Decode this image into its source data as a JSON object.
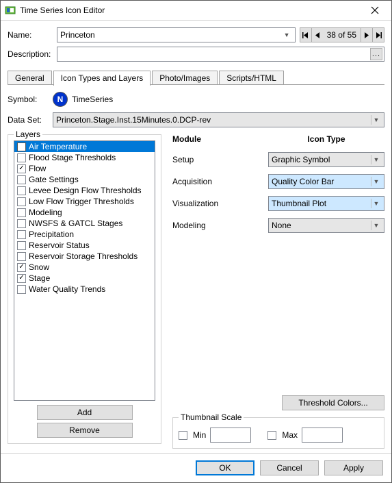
{
  "title": "Time Series Icon Editor",
  "pager": {
    "text": "38 of 55"
  },
  "form": {
    "name_label": "Name:",
    "name_value": "Princeton",
    "desc_label": "Description:",
    "desc_value": ""
  },
  "tabs": [
    "General",
    "Icon Types and Layers",
    "Photo/Images",
    "Scripts/HTML"
  ],
  "tabs_active_index": 1,
  "symbol": {
    "label": "Symbol:",
    "icon_letter": "N",
    "name": "TimeSeries"
  },
  "dataset": {
    "label": "Data Set:",
    "value": "Princeton.Stage.Inst.15Minutes.0.DCP-rev"
  },
  "layers": {
    "title": "Layers",
    "add": "Add",
    "remove": "Remove",
    "selected_index": 0,
    "items": [
      {
        "label": "Air Temperature",
        "checked": false
      },
      {
        "label": "Flood Stage Thresholds",
        "checked": false
      },
      {
        "label": "Flow",
        "checked": true
      },
      {
        "label": "Gate Settings",
        "checked": false
      },
      {
        "label": "Levee Design Flow Thresholds",
        "checked": false
      },
      {
        "label": "Low Flow Trigger Thresholds",
        "checked": false
      },
      {
        "label": "Modeling",
        "checked": false
      },
      {
        "label": "NWSFS & GATCL Stages",
        "checked": false
      },
      {
        "label": "Precipitation",
        "checked": false
      },
      {
        "label": "Reservoir Status",
        "checked": false
      },
      {
        "label": "Reservoir Storage Thresholds",
        "checked": false
      },
      {
        "label": "Snow",
        "checked": true
      },
      {
        "label": "Stage",
        "checked": true
      },
      {
        "label": "Water Quality Trends",
        "checked": false
      }
    ]
  },
  "modules": {
    "header_module": "Module",
    "header_icontype": "Icon Type",
    "rows": [
      {
        "label": "Setup",
        "value": "Graphic Symbol",
        "highlight": false
      },
      {
        "label": "Acquisition",
        "value": "Quality Color Bar",
        "highlight": true
      },
      {
        "label": "Visualization",
        "value": "Thumbnail Plot",
        "highlight": true
      },
      {
        "label": "Modeling",
        "value": "None",
        "highlight": false
      }
    ]
  },
  "threshold_btn": "Threshold Colors...",
  "thumbscale": {
    "title": "Thumbnail Scale",
    "min_label": "Min",
    "max_label": "Max",
    "min_value": "",
    "max_value": ""
  },
  "footer": {
    "ok": "OK",
    "cancel": "Cancel",
    "apply": "Apply"
  },
  "ellipsis": "..."
}
